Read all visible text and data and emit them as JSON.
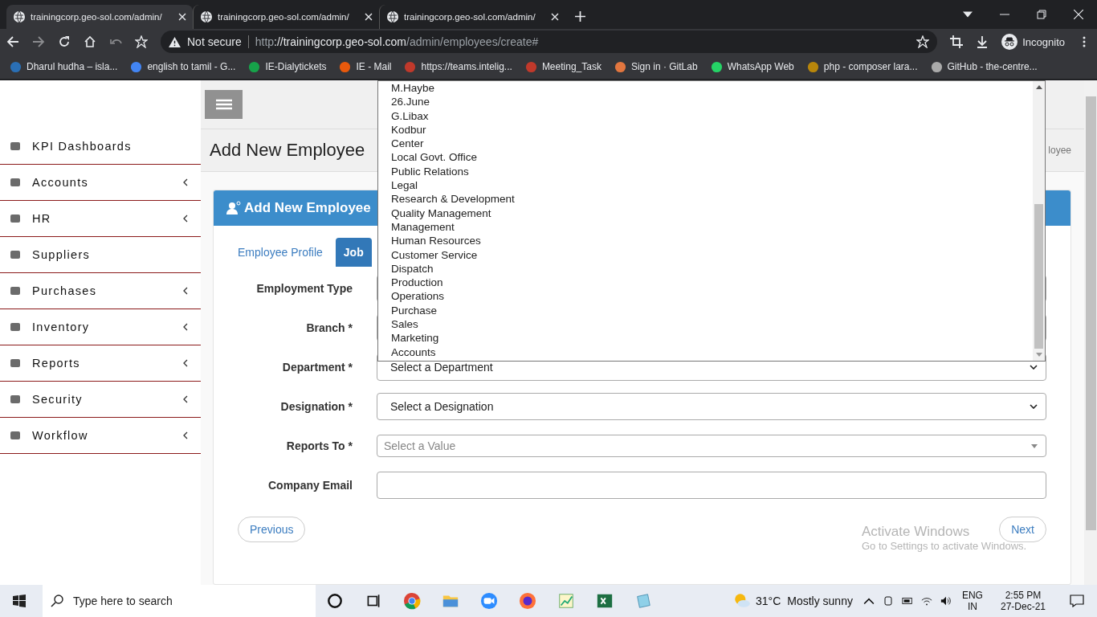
{
  "browser": {
    "tabs": [
      {
        "title": "trainingcorp.geo-sol.com/admin/",
        "selected": true
      },
      {
        "title": "trainingcorp.geo-sol.com/admin/",
        "selected": false
      },
      {
        "title": "trainingcorp.geo-sol.com/admin/",
        "selected": false
      }
    ],
    "security_label": "Not secure",
    "url": {
      "scheme": "http",
      "host": "://trainingcorp.geo-sol.com",
      "path": "/admin/employees/create#"
    },
    "profile": "Incognito",
    "bookmarks": [
      "Dharul hudha – isla...",
      "english to tamil - G...",
      "IE-Dialytickets",
      "IE - Mail",
      "https://teams.intelig...",
      "Meeting_Task",
      "Sign in · GitLab",
      "WhatsApp Web",
      "php - composer lara...",
      "GitHub - the-centre..."
    ]
  },
  "sidebar": {
    "items": [
      {
        "label": "KPI Dashboards",
        "has_submenu": false
      },
      {
        "label": "Accounts",
        "has_submenu": true
      },
      {
        "label": "HR",
        "has_submenu": true
      },
      {
        "label": "Suppliers",
        "has_submenu": false
      },
      {
        "label": "Purchases",
        "has_submenu": true
      },
      {
        "label": "Inventory",
        "has_submenu": true
      },
      {
        "label": "Reports",
        "has_submenu": true
      },
      {
        "label": "Security",
        "has_submenu": true
      },
      {
        "label": "Workflow",
        "has_submenu": true
      }
    ]
  },
  "page": {
    "title": "Add New Employee",
    "breadcrumb": "loyee"
  },
  "card": {
    "title": "Add New Employee",
    "tabs": [
      {
        "label": "Employee Profile",
        "selected": false
      },
      {
        "label": "Job",
        "selected": true
      }
    ],
    "fields": [
      {
        "label": "Employment Type",
        "kind": "select"
      },
      {
        "label": "Branch *",
        "kind": "select"
      },
      {
        "label": "Department *",
        "kind": "select",
        "value": "Select a Department"
      },
      {
        "label": "Designation *",
        "kind": "select",
        "value": "Select a Designation"
      },
      {
        "label": "Reports To *",
        "kind": "combo",
        "placeholder": "Select a Value"
      },
      {
        "label": "Company Email",
        "kind": "text"
      }
    ],
    "buttons": {
      "previous": "Previous",
      "next": "Next"
    }
  },
  "dropdown": {
    "options": [
      "M.Haybe",
      "26.June",
      "G.Libax",
      "Kodbur",
      "Center",
      "Local Govt. Office",
      "Public Relations",
      "Legal",
      "Research & Development",
      "Quality Management",
      "Management",
      "Human Resources",
      "Customer Service",
      "Dispatch",
      "Production",
      "Operations",
      "Purchase",
      "Sales",
      "Marketing",
      "Accounts"
    ]
  },
  "activation_notice": {
    "title": "Activate Windows",
    "subtitle": "Go to Settings to activate Windows."
  },
  "taskbar": {
    "search_placeholder": "Type here to search",
    "temperature": "31°C",
    "weather": "Mostly sunny",
    "language": "ENG",
    "region": "IN",
    "time": "2:55 PM",
    "date": "27-Dec-21"
  }
}
